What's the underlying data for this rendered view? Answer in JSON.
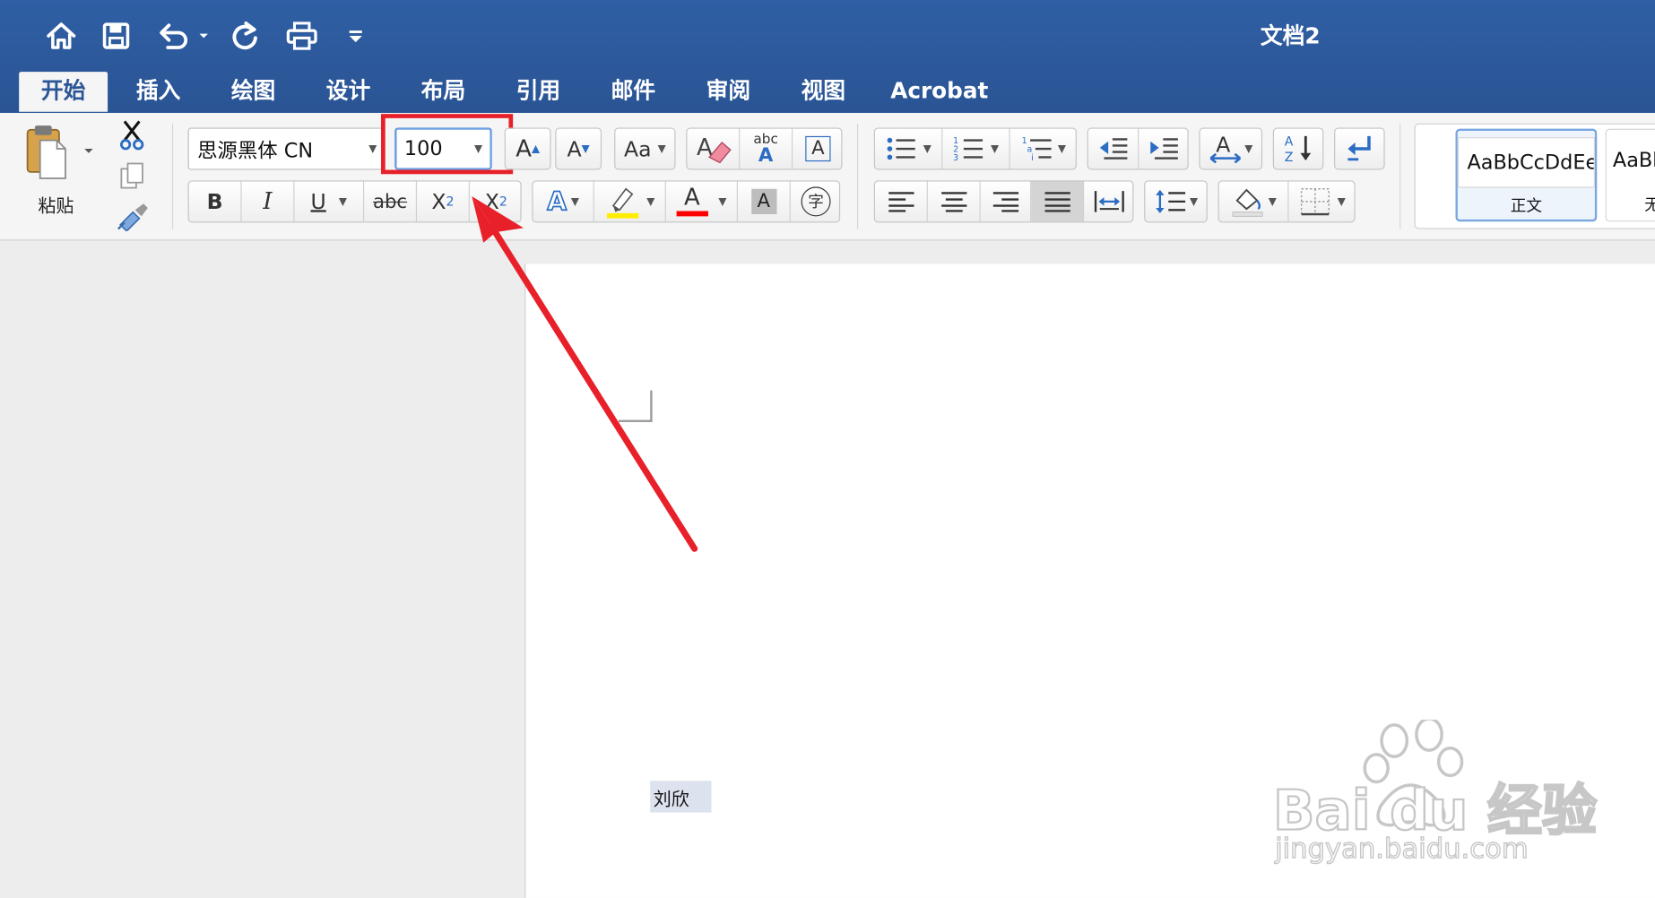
{
  "window": {
    "title": "文档2"
  },
  "tabs": [
    {
      "label": "开始",
      "active": true
    },
    {
      "label": "插入"
    },
    {
      "label": "绘图"
    },
    {
      "label": "设计"
    },
    {
      "label": "布局"
    },
    {
      "label": "引用"
    },
    {
      "label": "邮件"
    },
    {
      "label": "审阅"
    },
    {
      "label": "视图"
    },
    {
      "label": "Acrobat"
    }
  ],
  "clipboard": {
    "paste_label": "粘贴"
  },
  "font": {
    "name": "思源黑体 CN",
    "size": "100"
  },
  "format_labels": {
    "bold": "B",
    "italic": "I",
    "underline": "U",
    "strikethrough": "abc",
    "subscript": "X",
    "subscript_index": "2",
    "superscript": "X",
    "superscript_index": "2",
    "change_case": "Aa",
    "phonetic": "abc",
    "text_effects": "A",
    "font_color": "A",
    "char_shading": "A",
    "enclose": "字",
    "grow": "A",
    "shrink": "A",
    "char_border": "A"
  },
  "styles": [
    {
      "preview": "AaBbCcDdEe",
      "name": "正文",
      "selected": true
    },
    {
      "preview": "AaBbC",
      "name": "无"
    }
  ],
  "document": {
    "text": "刘欣"
  },
  "watermark": {
    "brand": "Bai du 经验",
    "url": "jingyan.baidu.com"
  },
  "colors": {
    "titlebar": "#2b5797",
    "ribbon": "#f5f5f5",
    "highlight_box": "#e8202a",
    "arrow": "#e8202a",
    "font_color_bar": "#ff0000",
    "highlighter_bar": "#ffee00",
    "selection": "#dde3ee"
  }
}
